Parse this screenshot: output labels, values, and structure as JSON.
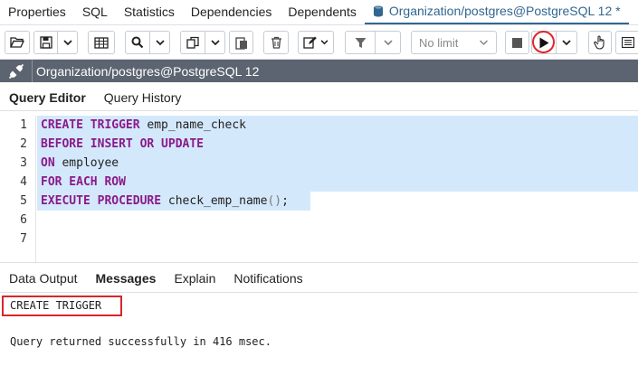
{
  "tabs": [
    {
      "label": "Properties"
    },
    {
      "label": "SQL"
    },
    {
      "label": "Statistics"
    },
    {
      "label": "Dependencies"
    },
    {
      "label": "Dependents"
    },
    {
      "label": "Organization/postgres@PostgreSQL 12 *",
      "active": true
    }
  ],
  "toolbar": {
    "limit_label": "No limit"
  },
  "connection": {
    "label": "Organization/postgres@PostgreSQL 12"
  },
  "editor_tabs": [
    {
      "label": "Query Editor",
      "active": true
    },
    {
      "label": "Query History"
    }
  ],
  "editor": {
    "line_numbers": [
      "1",
      "2",
      "3",
      "4",
      "5",
      "6",
      "7"
    ],
    "tokens": {
      "l1_kw": "CREATE TRIGGER",
      "l1_rest": " emp_name_check",
      "l2_kw": "BEFORE INSERT OR UPDATE",
      "l3_kw": "ON",
      "l3_rest": " employee",
      "l4_kw": "FOR EACH ROW",
      "l5_kw": "EXECUTE PROCEDURE",
      "l5_rest": " check_emp_name",
      "l5_paren": "()",
      "l5_end": ";"
    }
  },
  "output_tabs": [
    {
      "label": "Data Output"
    },
    {
      "label": "Messages",
      "active": true
    },
    {
      "label": "Explain"
    },
    {
      "label": "Notifications"
    }
  ],
  "messages": {
    "result": "CREATE TRIGGER",
    "status": "Query returned successfully in 416 msec."
  },
  "colors": {
    "accent": "#326690",
    "keyword": "#8a1a8a",
    "selection": "#d4e8fb",
    "highlight_red": "#d8262b",
    "connection_bar": "#5b6470"
  }
}
